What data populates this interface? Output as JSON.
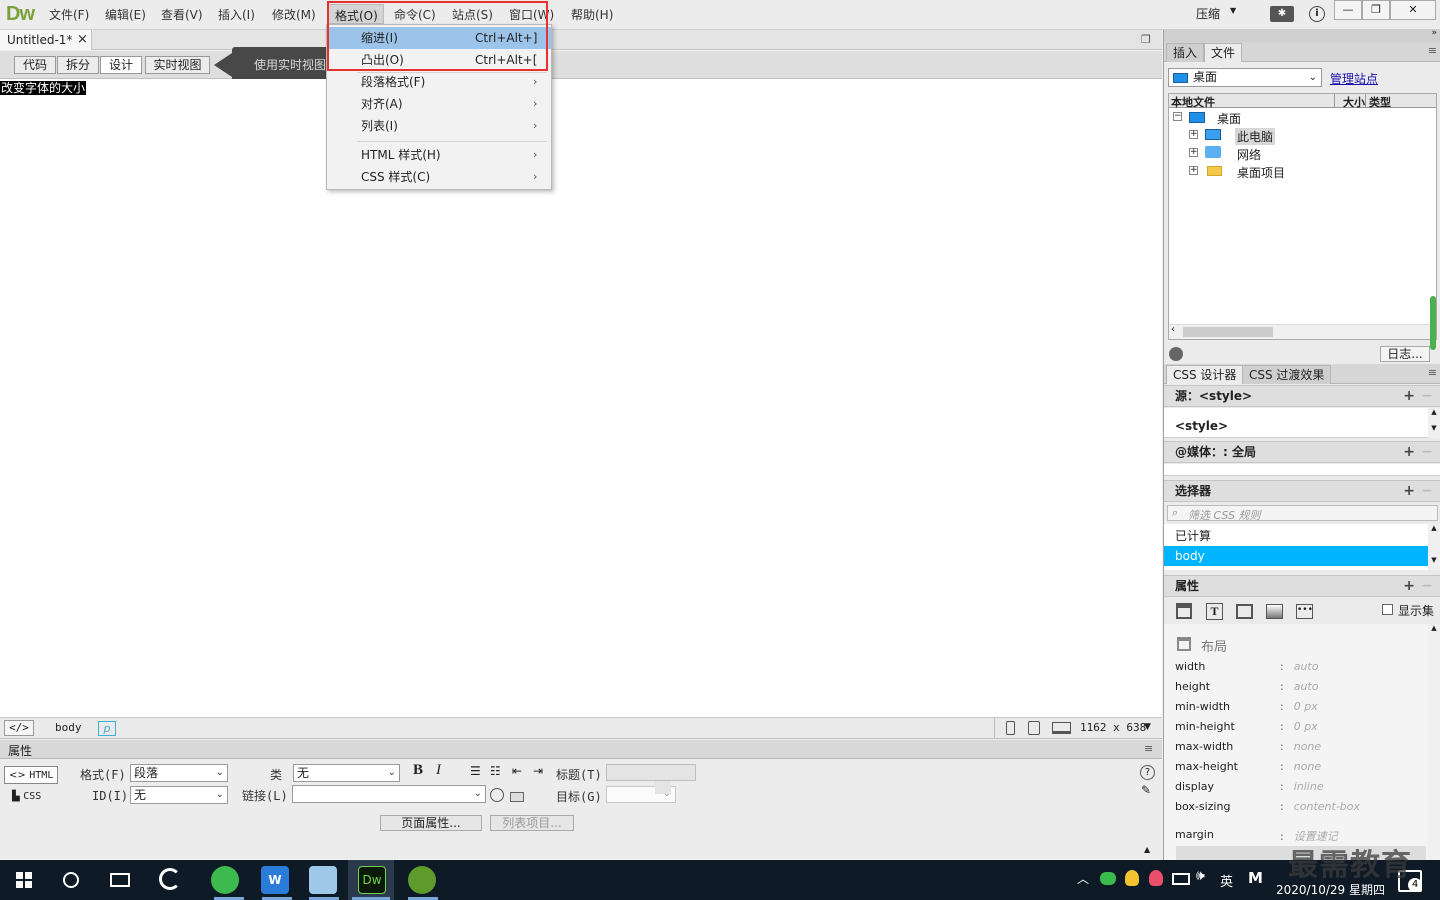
{
  "app": {
    "logo": "Dw"
  },
  "menubar": {
    "items": [
      "文件(F)",
      "编辑(E)",
      "查看(V)",
      "插入(I)",
      "修改(M)",
      "格式(O)",
      "命令(C)",
      "站点(S)",
      "窗口(W)",
      "帮助(H)"
    ],
    "compress_label": "压缩",
    "window_controls": {
      "minimize": "—",
      "restore": "❐",
      "close": "✕"
    }
  },
  "document": {
    "tab_title": "Untitled-1*",
    "close_glyph": "×",
    "view_buttons": [
      "代码",
      "拆分",
      "设计",
      "实时视图"
    ],
    "active_view": "设计",
    "tooltip": "使用实时视图",
    "selected_text": "改变字体的大小"
  },
  "format_menu": {
    "items": [
      {
        "label": "缩进(I)",
        "shortcut": "Ctrl+Alt+]",
        "highlighted": true
      },
      {
        "label": "凸出(O)",
        "shortcut": "Ctrl+Alt+["
      },
      {
        "label": "段落格式(F)",
        "submenu": true
      },
      {
        "label": "对齐(A)",
        "submenu": true
      },
      {
        "label": "列表(I)",
        "submenu": true
      },
      {
        "label": "HTML 样式(H)",
        "submenu": true
      },
      {
        "label": "CSS 样式(C)",
        "submenu": true
      }
    ],
    "submenu_glyph": "›",
    "highlight_color": "#9cc4ea",
    "box_color": "#e5312f"
  },
  "statusbar": {
    "tag_code": "</>",
    "tag_body": "body",
    "tag_p": "p",
    "dimensions": "1162 x 638"
  },
  "properties": {
    "header": "属性",
    "mode_html": "HTML",
    "mode_css": "CSS",
    "format_label": "格式(F)",
    "format_value": "段落",
    "id_label": "ID(I)",
    "id_value": "无",
    "class_label": "类",
    "class_value": "无",
    "link_label": "链接(L)",
    "title_label": "标题(T)",
    "target_label": "目标(G)",
    "bold": "B",
    "italic": "I",
    "page_props_button": "页面属性...",
    "list_item_button": "列表项目..."
  },
  "files_panel": {
    "tabs": [
      "插入",
      "文件"
    ],
    "active_tab": "文件",
    "location": "桌面",
    "manage_sites": "管理站点",
    "columns": [
      "本地文件",
      "大小",
      "类型"
    ],
    "tree": [
      {
        "label": "桌面",
        "level": 0
      },
      {
        "label": "此电脑",
        "level": 1
      },
      {
        "label": "网络",
        "level": 1
      },
      {
        "label": "桌面项目",
        "level": 1
      }
    ],
    "log_button": "日志..."
  },
  "css_panel": {
    "tabs": [
      "CSS 设计器",
      "CSS 过渡效果"
    ],
    "source_header": "源：<style>",
    "source_item": "<style>",
    "media_header": "@媒体：: 全局",
    "selector_header": "选择器",
    "filter_placeholder": "筛选 CSS 规则",
    "selectors": [
      "已计算",
      "body"
    ],
    "selected_selector": "body",
    "selection_color": "#00b4ff",
    "props_header": "属性",
    "show_set": "显示集",
    "layout_section": "布局",
    "props": [
      {
        "name": "width",
        "value": "auto"
      },
      {
        "name": "height",
        "value": "auto"
      },
      {
        "name": "min-width",
        "value": "0 px"
      },
      {
        "name": "min-height",
        "value": "0 px"
      },
      {
        "name": "max-width",
        "value": "none"
      },
      {
        "name": "max-height",
        "value": "none"
      },
      {
        "name": "display",
        "value": "inline"
      },
      {
        "name": "box-sizing",
        "value": "content-box"
      },
      {
        "name": "margin",
        "value": "设置速记"
      }
    ]
  },
  "taskbar": {
    "tray_lang": "英",
    "tray_m": "M",
    "clock": "2020/10/29 星期四",
    "notify_count": "4",
    "watermark": "最需教育"
  }
}
